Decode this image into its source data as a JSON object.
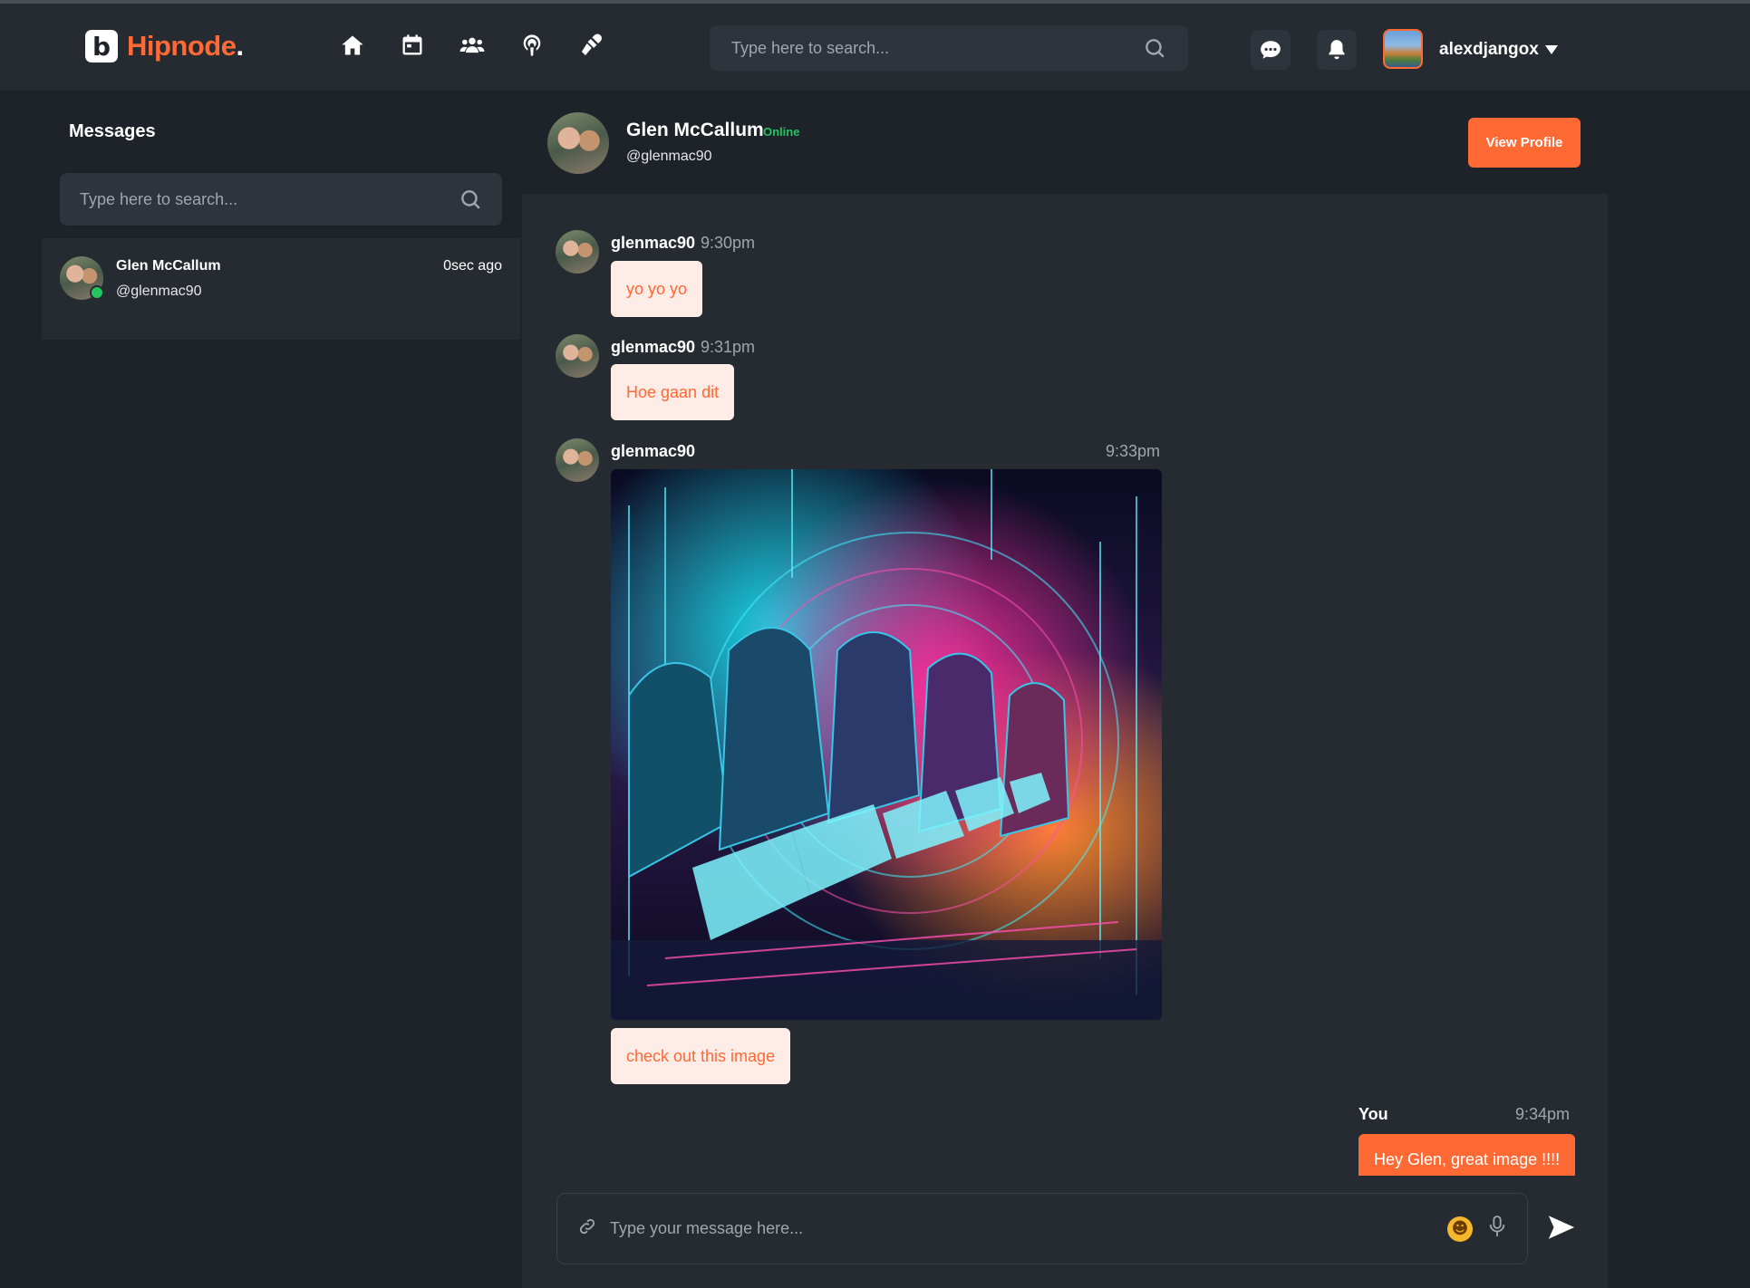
{
  "app": {
    "logo_letter": "b",
    "name": "Hipnode",
    "dot": "."
  },
  "colors": {
    "accent": "#ff6934",
    "online": "#22c55e",
    "bg": "#1e2329",
    "panel": "#262b31"
  },
  "nav": {
    "icons": [
      "home-icon",
      "calendar-icon",
      "groups-icon",
      "podcast-icon",
      "interview-icon"
    ]
  },
  "header": {
    "search_placeholder": "Type here to search...",
    "messages_icon": "chat-bubble-icon",
    "notifications_icon": "bell-icon",
    "username": "alexdjangox"
  },
  "sidebar": {
    "title": "Messages",
    "search_placeholder": "Type here to search...",
    "conversations": [
      {
        "name": "Glen McCallum",
        "handle": "@glenmac90",
        "time": "0sec ago",
        "online": true
      }
    ]
  },
  "chat": {
    "contact_name": "Glen McCallum",
    "status": "Online",
    "handle": "@glenmac90",
    "view_profile_label": "View Profile",
    "messages": [
      {
        "sender": "glenmac90",
        "time": "9:30pm",
        "text": "yo yo yo"
      },
      {
        "sender": "glenmac90",
        "time": "9:31pm",
        "text": "Hoe gaan dit"
      },
      {
        "sender": "glenmac90",
        "time": "9:33pm",
        "text": "check out this image"
      },
      {
        "sender": "You",
        "time": "9:34pm",
        "text": "Hey Glen, great image !!!!"
      }
    ],
    "input_placeholder": "Type your message here..."
  }
}
